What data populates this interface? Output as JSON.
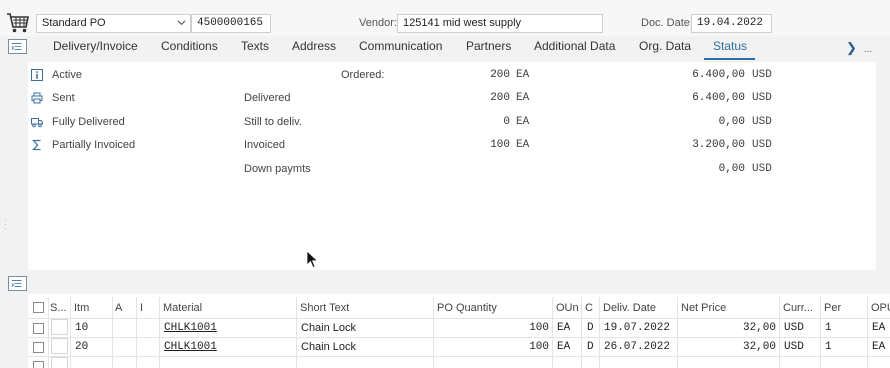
{
  "header": {
    "doc_type": "Standard PO",
    "po_number": "4500000165",
    "vendor_label": "Vendor:",
    "vendor_value": "125141 mid west supply",
    "doc_date_label": "Doc. Date:",
    "doc_date_value": "19.04.2022"
  },
  "tabs": [
    {
      "label": "Delivery/Invoice"
    },
    {
      "label": "Conditions"
    },
    {
      "label": "Texts"
    },
    {
      "label": "Address"
    },
    {
      "label": "Communication"
    },
    {
      "label": "Partners"
    },
    {
      "label": "Additional Data"
    },
    {
      "label": "Org. Data"
    },
    {
      "label": "Status"
    }
  ],
  "active_tab": "Status",
  "more_dots": "...",
  "status": {
    "items": [
      {
        "icon": "info-icon",
        "text": "Active"
      },
      {
        "icon": "printer-icon",
        "text": "Sent"
      },
      {
        "icon": "truck-icon",
        "text": "Fully Delivered"
      },
      {
        "icon": "sigma-icon",
        "text": "Partially Invoiced"
      }
    ],
    "rows": [
      {
        "label": "Ordered:",
        "qty": "200",
        "qty_unit": "EA",
        "amount": "6.400,00",
        "currency": "USD"
      },
      {
        "label": "Delivered",
        "qty": "200",
        "qty_unit": "EA",
        "amount": "6.400,00",
        "currency": "USD"
      },
      {
        "label": "Still to deliv.",
        "qty": "0",
        "qty_unit": "EA",
        "amount": "0,00",
        "currency": "USD"
      },
      {
        "label": "Invoiced",
        "qty": "100",
        "qty_unit": "EA",
        "amount": "3.200,00",
        "currency": "USD"
      },
      {
        "label": "Down paymts",
        "qty": "",
        "qty_unit": "",
        "amount": "0,00",
        "currency": "USD"
      }
    ]
  },
  "items_table": {
    "columns": [
      "S...",
      "Itm",
      "A",
      "I",
      "Material",
      "Short Text",
      "PO Quantity",
      "OUn",
      "C",
      "Deliv. Date",
      "Net Price",
      "Curr...",
      "Per",
      "OPU"
    ],
    "rows": [
      {
        "itm": "10",
        "material": "CHLK1001",
        "short_text": "Chain Lock",
        "po_qty": "100",
        "oun": "EA",
        "c": "D",
        "deliv_date": "19.07.2022",
        "net_price": "32,00",
        "curr": "USD",
        "per": "1",
        "opu": "EA"
      },
      {
        "itm": "20",
        "material": "CHLK1001",
        "short_text": "Chain Lock",
        "po_qty": "100",
        "oun": "EA",
        "c": "D",
        "deliv_date": "26.07.2022",
        "net_price": "32,00",
        "curr": "USD",
        "per": "1",
        "opu": "EA"
      }
    ]
  },
  "colors": {
    "accent": "#2f6ea8",
    "panel": "#ffffff",
    "background": "#f2f2f2"
  }
}
